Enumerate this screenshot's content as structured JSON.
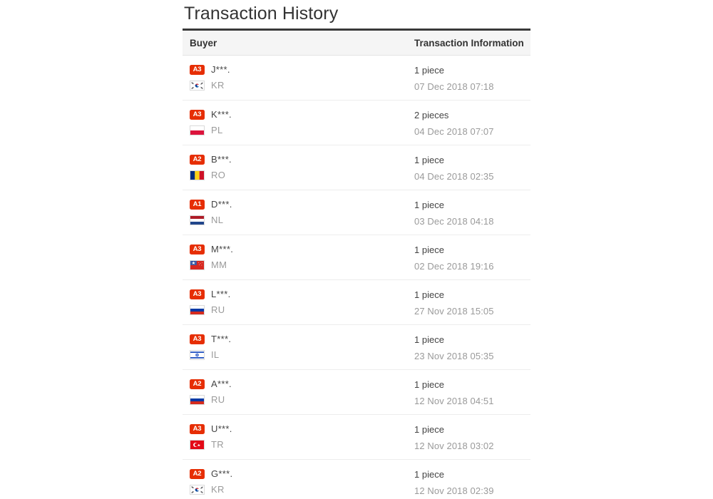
{
  "page": {
    "title": "Transaction History"
  },
  "table": {
    "columns": {
      "buyer": "Buyer",
      "info": "Transaction Information"
    },
    "rows": [
      {
        "level": "A3",
        "buyer_name": "J***.",
        "country_code": "KR",
        "flag": "kr-flag-icon",
        "quantity": "1 piece",
        "datetime": "07 Dec 2018 07:18"
      },
      {
        "level": "A3",
        "buyer_name": "K***.",
        "country_code": "PL",
        "flag": "pl-flag-icon",
        "quantity": "2 pieces",
        "datetime": "04 Dec 2018 07:07"
      },
      {
        "level": "A2",
        "buyer_name": "B***.",
        "country_code": "RO",
        "flag": "ro-flag-icon",
        "quantity": "1 piece",
        "datetime": "04 Dec 2018 02:35"
      },
      {
        "level": "A1",
        "buyer_name": "D***.",
        "country_code": "NL",
        "flag": "nl-flag-icon",
        "quantity": "1 piece",
        "datetime": "03 Dec 2018 04:18"
      },
      {
        "level": "A3",
        "buyer_name": "M***.",
        "country_code": "MM",
        "flag": "mm-flag-icon",
        "quantity": "1 piece",
        "datetime": "02 Dec 2018 19:16"
      },
      {
        "level": "A3",
        "buyer_name": "L***.",
        "country_code": "RU",
        "flag": "ru-flag-icon",
        "quantity": "1 piece",
        "datetime": "27 Nov 2018 15:05"
      },
      {
        "level": "A3",
        "buyer_name": "T***.",
        "country_code": "IL",
        "flag": "il-flag-icon",
        "quantity": "1 piece",
        "datetime": "23 Nov 2018 05:35"
      },
      {
        "level": "A2",
        "buyer_name": "A***.",
        "country_code": "RU",
        "flag": "ru-flag-icon",
        "quantity": "1 piece",
        "datetime": "12 Nov 2018 04:51"
      },
      {
        "level": "A3",
        "buyer_name": "U***.",
        "country_code": "TR",
        "flag": "tr-flag-icon",
        "quantity": "1 piece",
        "datetime": "12 Nov 2018 03:02"
      },
      {
        "level": "A2",
        "buyer_name": "G***.",
        "country_code": "KR",
        "flag": "kr-flag-icon",
        "quantity": "1 piece",
        "datetime": "12 Nov 2018 02:39"
      }
    ]
  },
  "colors": {
    "badge_red": "#e62e04",
    "header_rule": "#3a3a3a",
    "header_bg": "#f5f5f5",
    "row_divider": "#ededed",
    "muted_text": "#9a9a9a",
    "primary_text": "#444444"
  }
}
